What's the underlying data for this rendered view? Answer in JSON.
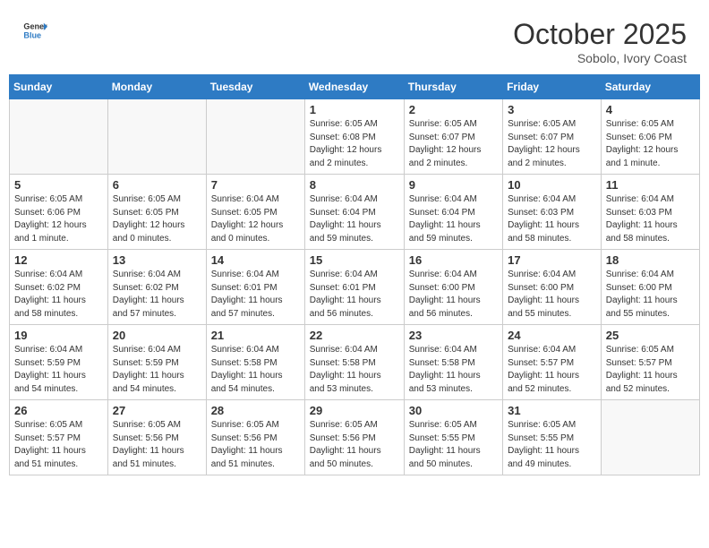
{
  "header": {
    "logo_general": "General",
    "logo_blue": "Blue",
    "month": "October 2025",
    "location": "Sobolo, Ivory Coast"
  },
  "weekdays": [
    "Sunday",
    "Monday",
    "Tuesday",
    "Wednesday",
    "Thursday",
    "Friday",
    "Saturday"
  ],
  "weeks": [
    [
      {
        "day": "",
        "info": ""
      },
      {
        "day": "",
        "info": ""
      },
      {
        "day": "",
        "info": ""
      },
      {
        "day": "1",
        "info": "Sunrise: 6:05 AM\nSunset: 6:08 PM\nDaylight: 12 hours\nand 2 minutes."
      },
      {
        "day": "2",
        "info": "Sunrise: 6:05 AM\nSunset: 6:07 PM\nDaylight: 12 hours\nand 2 minutes."
      },
      {
        "day": "3",
        "info": "Sunrise: 6:05 AM\nSunset: 6:07 PM\nDaylight: 12 hours\nand 2 minutes."
      },
      {
        "day": "4",
        "info": "Sunrise: 6:05 AM\nSunset: 6:06 PM\nDaylight: 12 hours\nand 1 minute."
      }
    ],
    [
      {
        "day": "5",
        "info": "Sunrise: 6:05 AM\nSunset: 6:06 PM\nDaylight: 12 hours\nand 1 minute."
      },
      {
        "day": "6",
        "info": "Sunrise: 6:05 AM\nSunset: 6:05 PM\nDaylight: 12 hours\nand 0 minutes."
      },
      {
        "day": "7",
        "info": "Sunrise: 6:04 AM\nSunset: 6:05 PM\nDaylight: 12 hours\nand 0 minutes."
      },
      {
        "day": "8",
        "info": "Sunrise: 6:04 AM\nSunset: 6:04 PM\nDaylight: 11 hours\nand 59 minutes."
      },
      {
        "day": "9",
        "info": "Sunrise: 6:04 AM\nSunset: 6:04 PM\nDaylight: 11 hours\nand 59 minutes."
      },
      {
        "day": "10",
        "info": "Sunrise: 6:04 AM\nSunset: 6:03 PM\nDaylight: 11 hours\nand 58 minutes."
      },
      {
        "day": "11",
        "info": "Sunrise: 6:04 AM\nSunset: 6:03 PM\nDaylight: 11 hours\nand 58 minutes."
      }
    ],
    [
      {
        "day": "12",
        "info": "Sunrise: 6:04 AM\nSunset: 6:02 PM\nDaylight: 11 hours\nand 58 minutes."
      },
      {
        "day": "13",
        "info": "Sunrise: 6:04 AM\nSunset: 6:02 PM\nDaylight: 11 hours\nand 57 minutes."
      },
      {
        "day": "14",
        "info": "Sunrise: 6:04 AM\nSunset: 6:01 PM\nDaylight: 11 hours\nand 57 minutes."
      },
      {
        "day": "15",
        "info": "Sunrise: 6:04 AM\nSunset: 6:01 PM\nDaylight: 11 hours\nand 56 minutes."
      },
      {
        "day": "16",
        "info": "Sunrise: 6:04 AM\nSunset: 6:00 PM\nDaylight: 11 hours\nand 56 minutes."
      },
      {
        "day": "17",
        "info": "Sunrise: 6:04 AM\nSunset: 6:00 PM\nDaylight: 11 hours\nand 55 minutes."
      },
      {
        "day": "18",
        "info": "Sunrise: 6:04 AM\nSunset: 6:00 PM\nDaylight: 11 hours\nand 55 minutes."
      }
    ],
    [
      {
        "day": "19",
        "info": "Sunrise: 6:04 AM\nSunset: 5:59 PM\nDaylight: 11 hours\nand 54 minutes."
      },
      {
        "day": "20",
        "info": "Sunrise: 6:04 AM\nSunset: 5:59 PM\nDaylight: 11 hours\nand 54 minutes."
      },
      {
        "day": "21",
        "info": "Sunrise: 6:04 AM\nSunset: 5:58 PM\nDaylight: 11 hours\nand 54 minutes."
      },
      {
        "day": "22",
        "info": "Sunrise: 6:04 AM\nSunset: 5:58 PM\nDaylight: 11 hours\nand 53 minutes."
      },
      {
        "day": "23",
        "info": "Sunrise: 6:04 AM\nSunset: 5:58 PM\nDaylight: 11 hours\nand 53 minutes."
      },
      {
        "day": "24",
        "info": "Sunrise: 6:04 AM\nSunset: 5:57 PM\nDaylight: 11 hours\nand 52 minutes."
      },
      {
        "day": "25",
        "info": "Sunrise: 6:05 AM\nSunset: 5:57 PM\nDaylight: 11 hours\nand 52 minutes."
      }
    ],
    [
      {
        "day": "26",
        "info": "Sunrise: 6:05 AM\nSunset: 5:57 PM\nDaylight: 11 hours\nand 51 minutes."
      },
      {
        "day": "27",
        "info": "Sunrise: 6:05 AM\nSunset: 5:56 PM\nDaylight: 11 hours\nand 51 minutes."
      },
      {
        "day": "28",
        "info": "Sunrise: 6:05 AM\nSunset: 5:56 PM\nDaylight: 11 hours\nand 51 minutes."
      },
      {
        "day": "29",
        "info": "Sunrise: 6:05 AM\nSunset: 5:56 PM\nDaylight: 11 hours\nand 50 minutes."
      },
      {
        "day": "30",
        "info": "Sunrise: 6:05 AM\nSunset: 5:55 PM\nDaylight: 11 hours\nand 50 minutes."
      },
      {
        "day": "31",
        "info": "Sunrise: 6:05 AM\nSunset: 5:55 PM\nDaylight: 11 hours\nand 49 minutes."
      },
      {
        "day": "",
        "info": ""
      }
    ]
  ]
}
